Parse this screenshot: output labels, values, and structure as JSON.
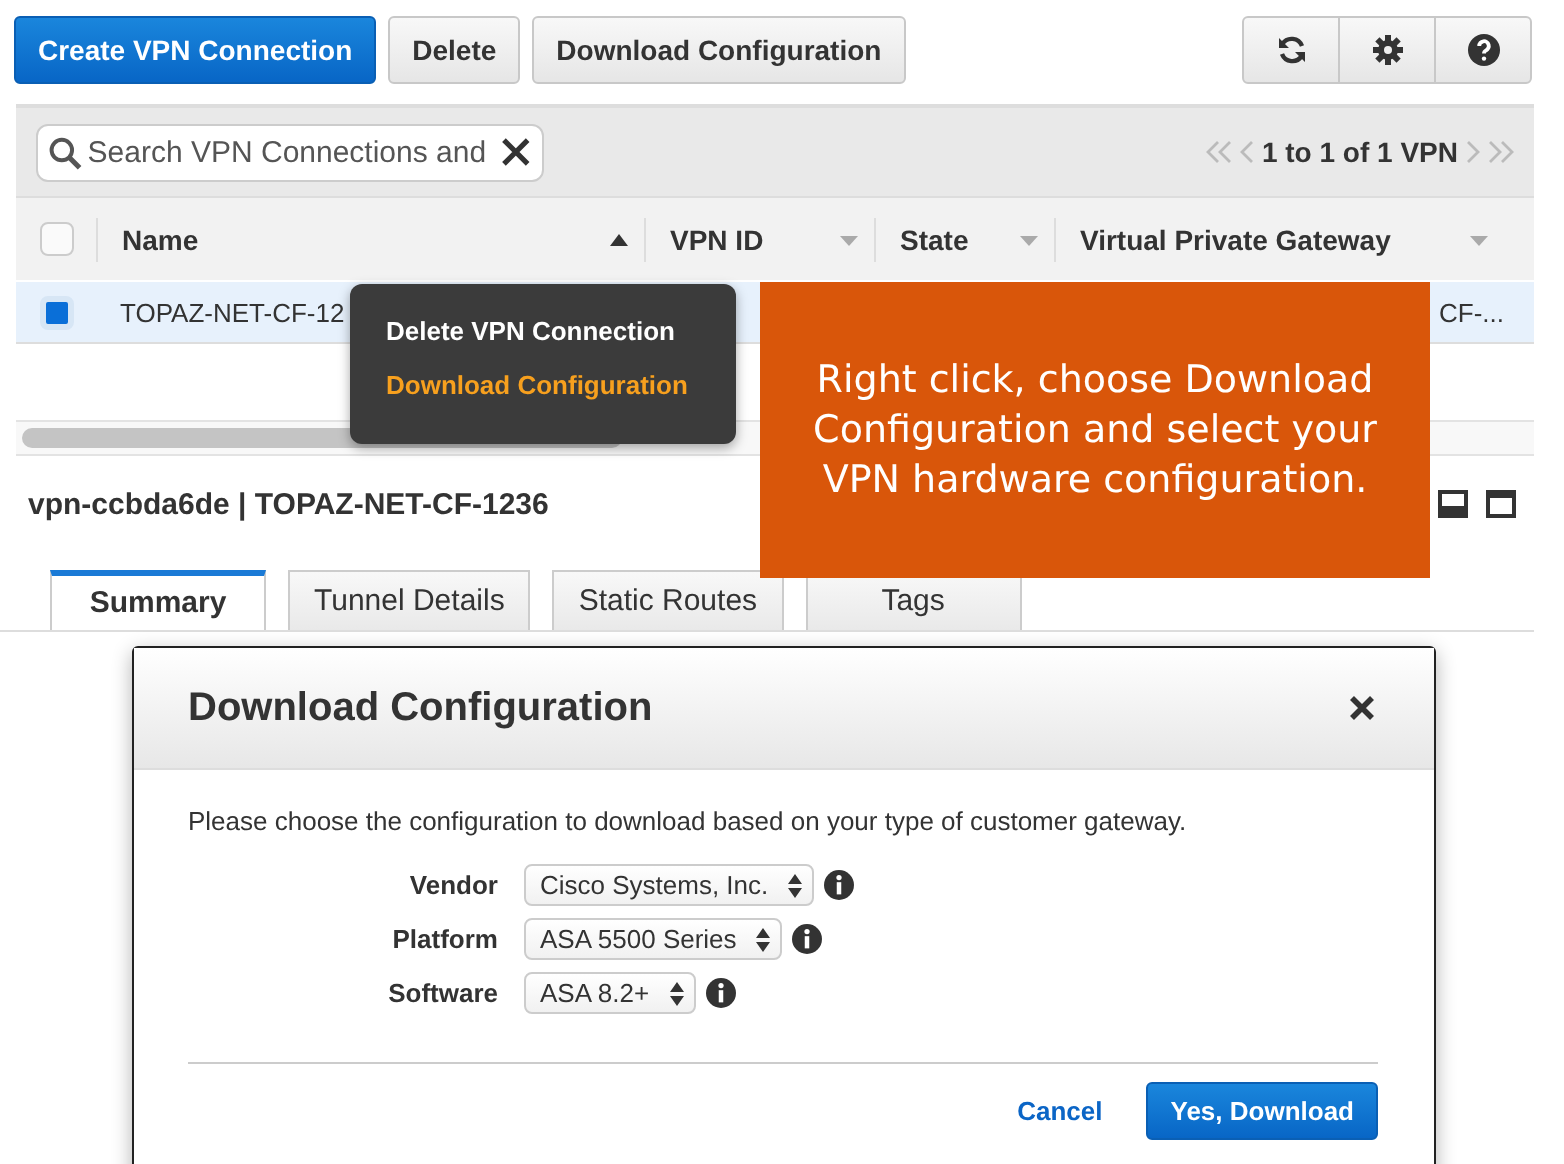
{
  "toolbar": {
    "buttons": [
      {
        "label": "Create VPN Connection",
        "kind": "primary"
      },
      {
        "label": "Delete",
        "kind": "default"
      },
      {
        "label": "Download Configuration",
        "kind": "default"
      }
    ]
  },
  "search": {
    "placeholder": "Search VPN Connections and"
  },
  "pagination": {
    "text": "1 to 1 of 1 VPN"
  },
  "table": {
    "select_all_checked": false,
    "columns": [
      {
        "label": "Name",
        "sorted": true
      },
      {
        "label": "VPN ID",
        "sorted": false
      },
      {
        "label": "State",
        "sorted": false
      },
      {
        "label": "Virtual Private Gateway",
        "sorted": false
      }
    ],
    "rows": [
      {
        "selected": true,
        "name": "TOPAZ-NET-CF-12",
        "virtual_private_gateway": "CF-..."
      }
    ]
  },
  "details": {
    "title": "vpn-ccbda6de | TOPAZ-NET-CF-1236",
    "tabs": [
      {
        "label": "Summary",
        "selected": true
      },
      {
        "label": "Tunnel Details",
        "selected": false
      },
      {
        "label": "Static Routes",
        "selected": false
      },
      {
        "label": "Tags",
        "selected": false
      }
    ]
  },
  "context_menu": {
    "items": [
      {
        "label": "Delete VPN Connection",
        "highlighted": false
      },
      {
        "label": "Download Configuration",
        "highlighted": true
      }
    ]
  },
  "callout": {
    "text": "Right click, choose Download Configuration and select your VPN hardware configuration."
  },
  "dialog": {
    "title": "Download Configuration",
    "message": "Please choose the configuration to download based on your type of customer gateway.",
    "fields": [
      {
        "label": "Vendor",
        "value": "Cisco Systems, Inc."
      },
      {
        "label": "Platform",
        "value": "ASA 5500 Series"
      },
      {
        "label": "Software",
        "value": "ASA 8.2+"
      }
    ],
    "buttons": [
      {
        "label": "Cancel",
        "kind": "link"
      },
      {
        "label": "Yes, Download",
        "kind": "primary"
      }
    ]
  }
}
